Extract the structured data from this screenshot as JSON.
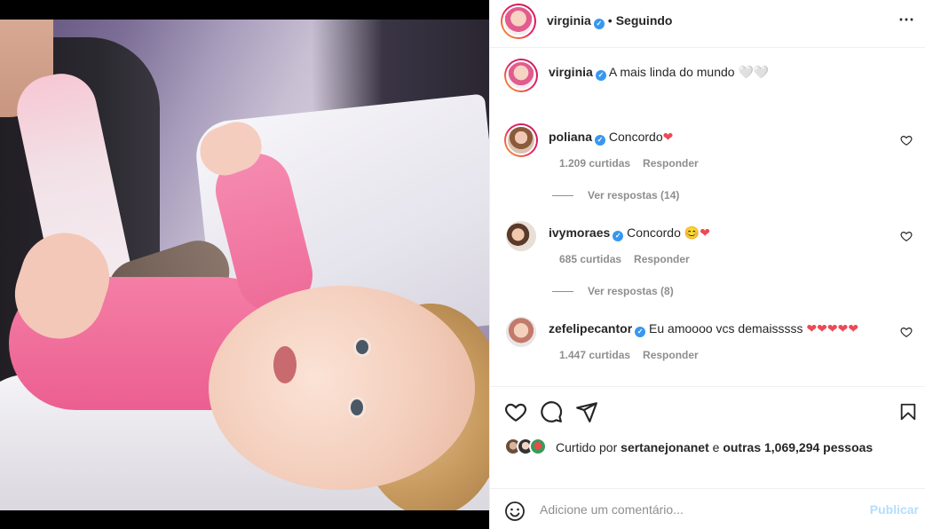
{
  "post": {
    "username": "virginia",
    "follow_status": "Seguindo",
    "caption_user": "virginia",
    "caption_text": "A mais linda do mundo 🤍🤍"
  },
  "comments": [
    {
      "username": "poliana",
      "text": "Concordo",
      "emoji": "❤",
      "likes": "1.209 curtidas",
      "reply": "Responder",
      "view_replies": "Ver respostas (14)"
    },
    {
      "username": "ivymoraes",
      "text": "Concordo",
      "emoji": "😊❤",
      "likes": "685 curtidas",
      "reply": "Responder",
      "view_replies": "Ver respostas (8)"
    },
    {
      "username": "zefelipecantor",
      "text": "Eu amoooo vcs demaisssss",
      "emoji": "❤❤❤❤❤",
      "likes": "1.447 curtidas",
      "reply": "Responder"
    }
  ],
  "likes": {
    "prefix": "Curtido por",
    "user": "sertanejonanet",
    "middle": "e",
    "others": "outras 1,069,294 pessoas"
  },
  "comment_box": {
    "placeholder": "Adicione um comentário...",
    "publish_label": "Publicar"
  },
  "icons": {
    "more": "more-options-icon",
    "like": "heart-icon",
    "comment": "comment-icon",
    "share": "share-icon",
    "save": "bookmark-icon",
    "emoji": "emoji-icon"
  },
  "colors": {
    "verified": "#3897f0",
    "publish_disabled": "#b2dffc",
    "muted": "#8e8e8e"
  }
}
